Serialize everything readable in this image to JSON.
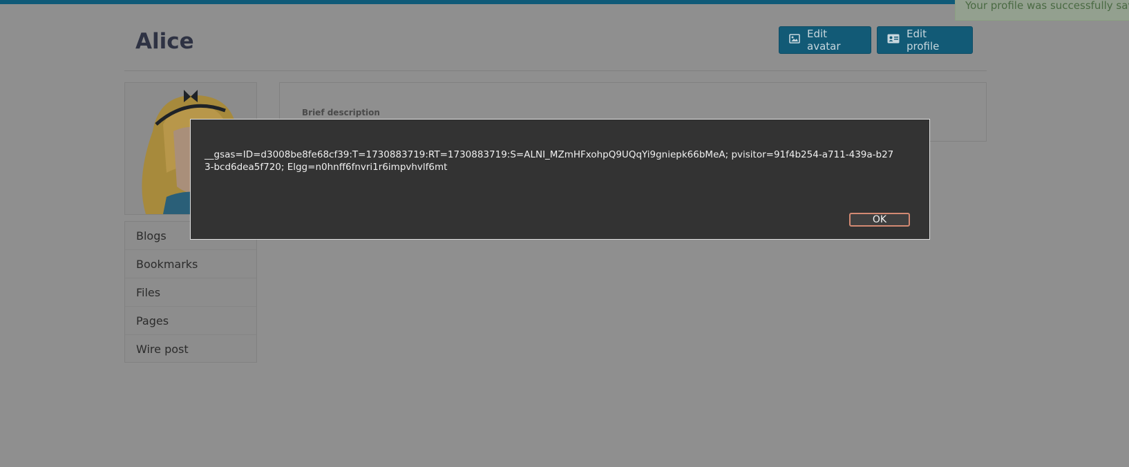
{
  "header": {
    "title": "Alice",
    "edit_avatar_label": "Edit avatar",
    "edit_profile_label": "Edit profile",
    "edit_avatar_icon": "image-icon",
    "edit_profile_icon": "id-card-icon"
  },
  "toast": {
    "message": "Your profile was successfully saved."
  },
  "sidebar": {
    "items": [
      {
        "label": "Blogs"
      },
      {
        "label": "Bookmarks"
      },
      {
        "label": "Files"
      },
      {
        "label": "Pages"
      },
      {
        "label": "Wire post"
      }
    ]
  },
  "profile": {
    "brief_description_label": "Brief description"
  },
  "dialog": {
    "message": "__gsas=ID=d3008be8fe68cf39:T=1730883719:RT=1730883719:S=ALNI_MZmHFxohpQ9UQqYi9gniepk66bMeA; pvisitor=91f4b254-a711-439a-b273-bcd6dea5f720; Elgg=n0hnff6fnvri1r6impvhvlf6mt",
    "ok_label": "OK"
  },
  "colors": {
    "accent": "#125a76",
    "overlay": "#8f8f8f",
    "dialog_bg": "#333333",
    "ok_border": "#d48a73"
  }
}
